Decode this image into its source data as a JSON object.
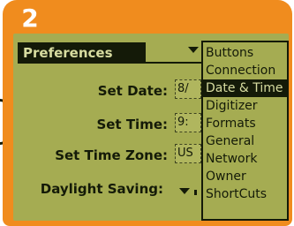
{
  "step_number": "2",
  "app": {
    "title": "Preferences"
  },
  "form": {
    "set_date_label": "Set Date:",
    "set_date_value": "8/",
    "set_time_label": "Set Time:",
    "set_time_value": "9:",
    "set_time_zone_label": "Set Time Zone:",
    "set_time_zone_value": "US",
    "daylight_saving_label": "Daylight Saving:"
  },
  "menu": {
    "items": [
      "Buttons",
      "Connection",
      "Date & Time",
      "Digitizer",
      "Formats",
      "General",
      "Network",
      "Owner",
      "ShortCuts"
    ],
    "selected": "Date & Time"
  },
  "colors": {
    "frame": "#f08c1e",
    "screen": "#a5ac52",
    "ink": "#141a08"
  }
}
